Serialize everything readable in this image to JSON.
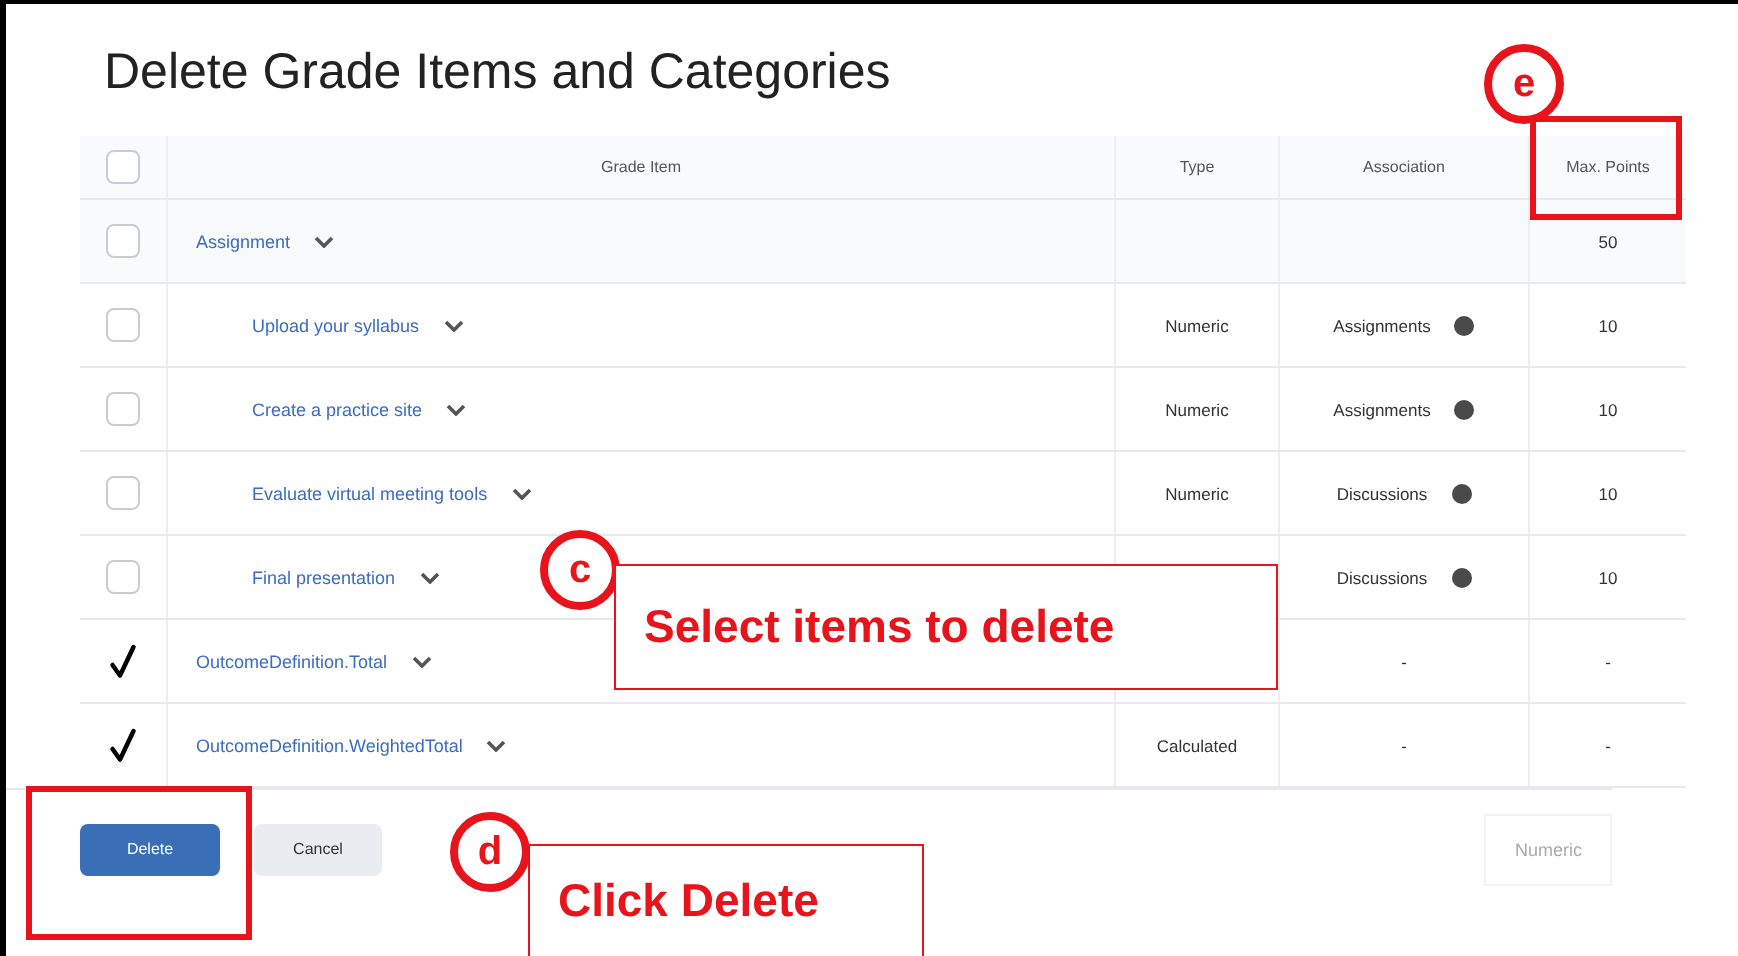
{
  "title": "Delete Grade Items and Categories",
  "table": {
    "header_checked": false,
    "columns": [
      "Grade Item",
      "Type",
      "Association",
      "Max. Points"
    ],
    "rows": [
      {
        "name": "Assignment",
        "checked": false,
        "max_points": "50",
        "children": [
          {
            "name": "Upload your syllabus",
            "checked": false,
            "type": "Numeric",
            "association": "Assignments",
            "max_points": "10"
          },
          {
            "name": "Create a practice site",
            "checked": false,
            "type": "Numeric",
            "association": "Assignments",
            "max_points": "10"
          },
          {
            "name": "Evaluate virtual meeting tools",
            "checked": false,
            "type": "Numeric",
            "association": "Discussions",
            "max_points": "10"
          },
          {
            "name": "Final presentation",
            "checked": false,
            "association": "Discussions",
            "max_points": "10"
          }
        ]
      },
      {
        "name": "OutcomeDefinition.Total",
        "checked": true,
        "association": "-",
        "max_points": "-"
      },
      {
        "name": "OutcomeDefinition.WeightedTotal",
        "checked": true,
        "type": "Calculated",
        "association": "-",
        "max_points": "-"
      }
    ]
  },
  "buttons": [
    {
      "label": "Delete",
      "kind": "primary"
    },
    {
      "label": "Cancel",
      "kind": "secondary"
    }
  ],
  "faded_text": "Numeric",
  "annotations": [
    {
      "label": "e"
    },
    {
      "label": "c",
      "text": "Select items to delete"
    },
    {
      "label": "d",
      "text": "Click Delete"
    }
  ]
}
